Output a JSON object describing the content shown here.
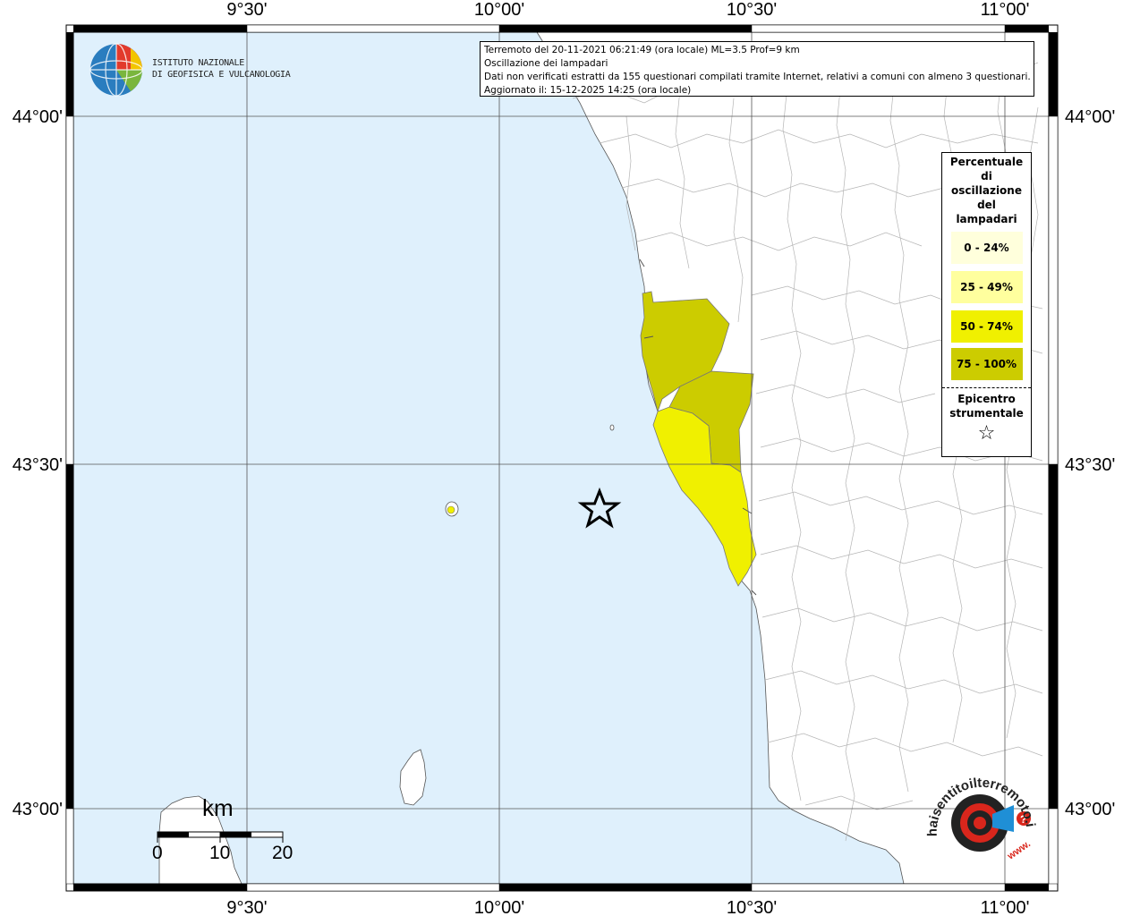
{
  "info": {
    "line1": "Terremoto del 20-11-2021 06:21:49 (ora locale) ML=3.5 Prof=9 km",
    "line2": "Oscillazione dei lampadari",
    "line3": "Dati non verificati estratti da 155 questionari compilati tramite Internet, relativi a comuni con almeno 3 questionari.",
    "line4": "Aggiornato il: 15-12-2025 14:25 (ora locale)"
  },
  "logo": {
    "line1": "ISTITUTO NAZIONALE",
    "line2": "DI GEOFISICA E VULCANOLOGIA"
  },
  "axes": {
    "top": [
      "9°30'",
      "10°00'",
      "10°30'",
      "11°00'"
    ],
    "bottom": [
      "9°30'",
      "10°00'",
      "10°30'",
      "11°00'"
    ],
    "left": [
      "44°00'",
      "43°30'",
      "43°00'"
    ],
    "right": [
      "44°00'",
      "43°30'",
      "43°00'"
    ]
  },
  "legend": {
    "title": [
      "Percentuale",
      "di",
      "oscillazione",
      "del",
      "lampadari"
    ],
    "classes": [
      {
        "label": "0 - 24%",
        "color": "#ffffdc"
      },
      {
        "label": "25 - 49%",
        "color": "#ffff9e"
      },
      {
        "label": "50 - 74%",
        "color": "#f0f000"
      },
      {
        "label": "75 - 100%",
        "color": "#cccc00"
      }
    ],
    "epicenter_title": [
      "Epicentro",
      "strumentale"
    ],
    "epicenter_symbol": "☆"
  },
  "scale": {
    "unit": "km",
    "ticks": [
      "0",
      "10",
      "20"
    ]
  },
  "watermark": {
    "text": "haisentitoilterremoto.it",
    "sub": "www."
  },
  "colors": {
    "sea": "#dff0fc",
    "land": "#ffffff",
    "class_50_74": "#f0f000",
    "class_75_100": "#cccc00"
  }
}
